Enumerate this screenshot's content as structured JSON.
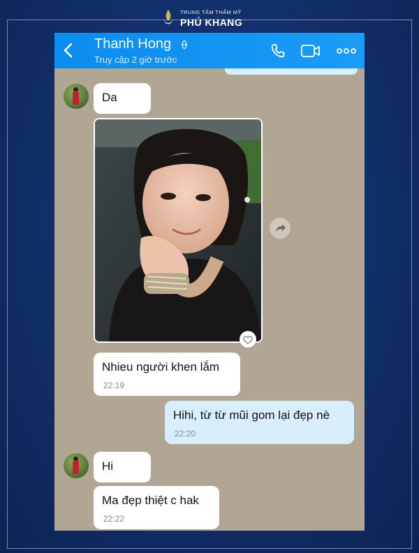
{
  "brand": {
    "tagline": "TRUNG TÂM THẨM MỸ",
    "name": "PHÚ KHANG"
  },
  "header": {
    "contact_name": "Thanh Hong",
    "status": "Truy cập 2 giờ trước",
    "icons": [
      "back-arrow-icon",
      "bio-icon",
      "phone-icon",
      "video-call-icon",
      "more-icon"
    ],
    "accent_color": "#1795f2"
  },
  "messages": [
    {
      "side": "in",
      "text": "Da"
    },
    {
      "side": "in",
      "type": "image",
      "alt_subject": "selfie photo"
    },
    {
      "side": "in",
      "text": "Nhieu người khen lắm",
      "time": "22:19"
    },
    {
      "side": "out",
      "text": "Hihi, từ từ mũi gom lại đẹp nè",
      "time": "22:20"
    },
    {
      "side": "in",
      "text": "Hi"
    },
    {
      "side": "in",
      "text": "Ma đẹp thiệt c hak",
      "time": "22:22"
    }
  ],
  "colors": {
    "chat_background": "#b1a593",
    "outgoing_bubble": "#d9eefd",
    "incoming_bubble": "#ffffff",
    "page_background": "#12306c"
  }
}
